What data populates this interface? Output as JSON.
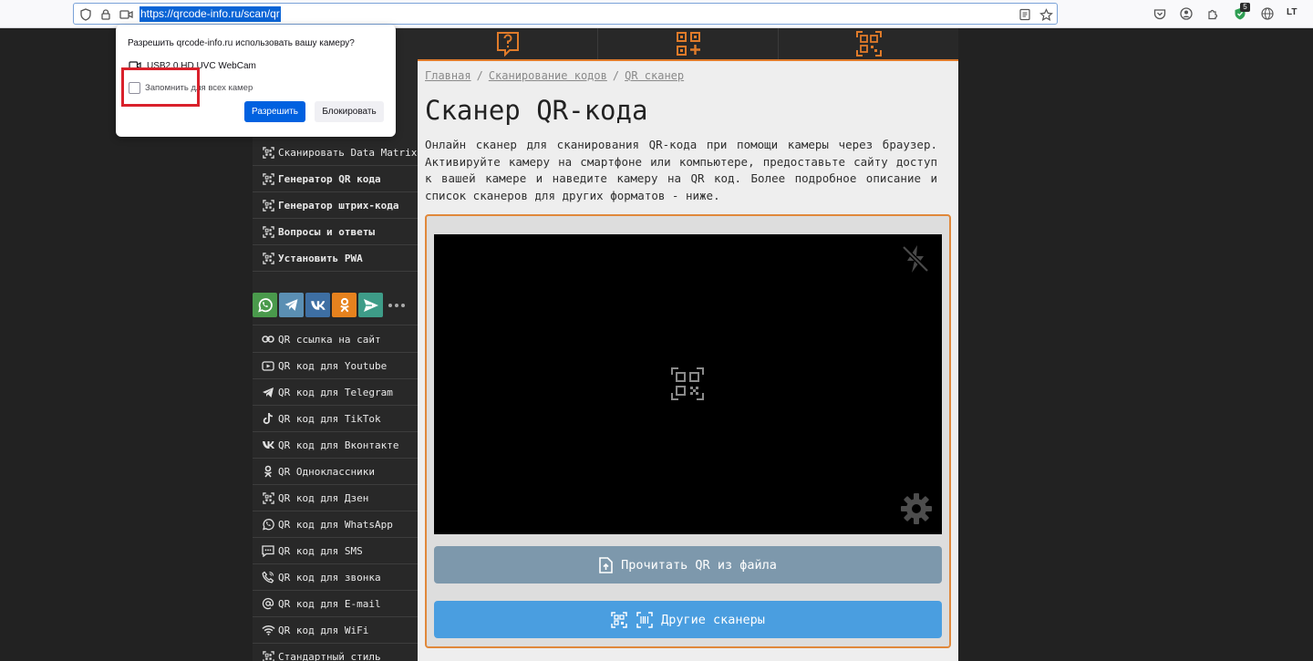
{
  "browser": {
    "url": "https://qrcode-info.ru/scan/qr",
    "extension_badge": "5",
    "profile_label": "LT"
  },
  "permission_popup": {
    "title": "Разрешить qrcode-info.ru использовать вашу камеру?",
    "device": "USB2.0 HD UVC WebCam",
    "remember_label": "Запомнить для всех камер",
    "remember_checked": false,
    "allow_label": "Разрешить",
    "block_label": "Блокировать"
  },
  "sidebar": {
    "top_items": [
      {
        "label": "Сканировать Data Matrix",
        "bold": false,
        "icon": "qr-icon"
      },
      {
        "label": "Генератор QR кода",
        "bold": true,
        "icon": "qr-icon"
      },
      {
        "label": "Генератор штрих-кода",
        "bold": true,
        "icon": "qr-icon"
      },
      {
        "label": "Вопросы и ответы",
        "bold": true,
        "icon": "qr-icon"
      },
      {
        "label": "Установить PWA",
        "bold": true,
        "icon": "qr-icon"
      }
    ],
    "social": [
      {
        "name": "whatsapp",
        "color": "#4a9a4c"
      },
      {
        "name": "telegram",
        "color": "#5b8fb3"
      },
      {
        "name": "vk",
        "color": "#3e6fa3"
      },
      {
        "name": "odnoklassniki",
        "color": "#e6821e"
      },
      {
        "name": "share",
        "color": "#3e9c88"
      }
    ],
    "bottom_items": [
      {
        "label": "QR ссылка на сайт",
        "icon": "link-icon"
      },
      {
        "label": "QR код для Youtube",
        "icon": "youtube-icon"
      },
      {
        "label": "QR код для Telegram",
        "icon": "telegram-icon"
      },
      {
        "label": "QR код для TikTok",
        "icon": "tiktok-icon"
      },
      {
        "label": "QR код для Вконтакте",
        "icon": "vk-icon"
      },
      {
        "label": "QR Одноклассники",
        "icon": "odnoklassniki-icon"
      },
      {
        "label": "QR код для Дзен",
        "icon": "qr-icon"
      },
      {
        "label": "QR код для WhatsApp",
        "icon": "whatsapp-icon"
      },
      {
        "label": "QR код для SMS",
        "icon": "sms-icon"
      },
      {
        "label": "QR код для звонка",
        "icon": "phone-icon"
      },
      {
        "label": "QR код для E-mail",
        "icon": "at-icon"
      },
      {
        "label": "QR код для WiFi",
        "icon": "wifi-icon"
      },
      {
        "label": "Стандартный стиль",
        "icon": "qr-icon"
      }
    ]
  },
  "top_nav": {
    "items": [
      {
        "icon": "question-icon"
      },
      {
        "icon": "qr-plus-icon"
      },
      {
        "icon": "qr-scan-icon"
      }
    ],
    "accent_color": "#e07b2a"
  },
  "breadcrumb": {
    "items": [
      "Главная",
      "Сканирование кодов",
      "QR сканер"
    ],
    "separator": "/"
  },
  "page": {
    "title": "Сканер QR-кода",
    "intro": "Онлайн сканер для сканирования QR-кода при помощи камеры через браузер. Активируйте камеру на смартфоне или компьютере, предоставьте сайту доступ к вашей камере и наведите камеру на QR код. Более подробное описание и список сканеров для других форматов - ниже."
  },
  "scanner": {
    "read_file_label": "Прочитать QR из файла",
    "other_scanners_label": "Другие сканеры"
  }
}
